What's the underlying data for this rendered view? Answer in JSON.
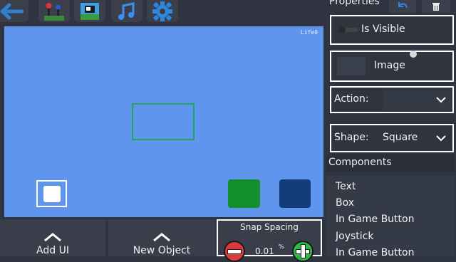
{
  "toolbar": {
    "icons": [
      "back-arrow-icon",
      "joystick-icon",
      "image-icon",
      "music-icon",
      "gear-icon"
    ]
  },
  "canvas": {
    "life_counter": "Life0"
  },
  "bottom_bar": {
    "add_ui_label": "Add UI",
    "new_object_label": "New Object",
    "snap": {
      "title": "Snap Spacing",
      "value": "0.01",
      "unit": "%"
    }
  },
  "properties": {
    "title": "Properties",
    "is_visible_label": "Is Visible",
    "image_label": "Image",
    "action_label": "Action:",
    "action_value": "",
    "shape_label": "Shape:",
    "shape_value": "Square"
  },
  "components": {
    "header": "Components",
    "items": [
      "Text",
      "Box",
      "In Game Button",
      "Joystick",
      "In Game Button"
    ]
  },
  "colors": {
    "canvas_bg": "#6095ee",
    "green_button": "#12902d",
    "blue_button": "#133c7a",
    "selection_outline": "#23a55a"
  }
}
